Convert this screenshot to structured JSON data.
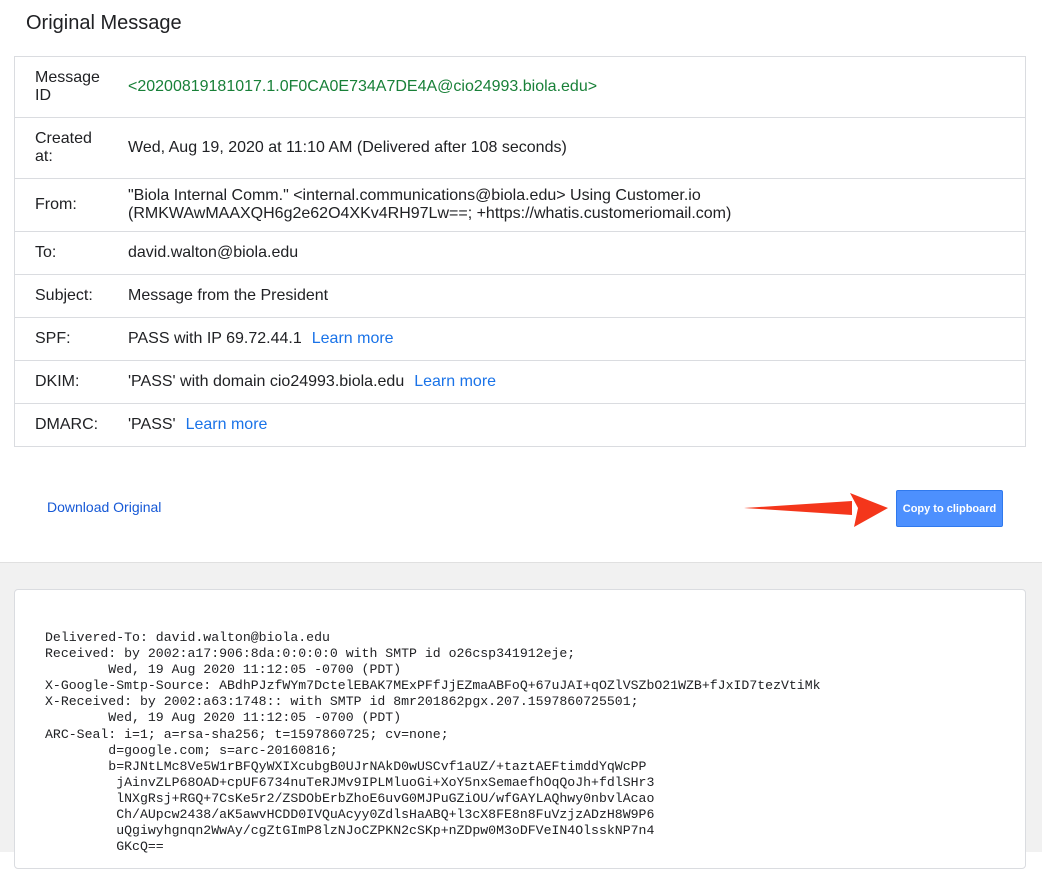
{
  "page_title": "Original Message",
  "details": {
    "message_id": {
      "label": "Message ID",
      "value": "<20200819181017.1.0F0CA0E734A7DE4A@cio24993.biola.edu>"
    },
    "created": {
      "label": "Created at:",
      "value": "Wed, Aug 19, 2020 at 11:10 AM (Delivered after 108 seconds)"
    },
    "from": {
      "label": "From:",
      "value": "\"Biola Internal Comm.\" <internal.communications@biola.edu> Using Customer.io (RMKWAwMAAXQH6g2e62O4XKv4RH97Lw==; +https://whatis.customeriomail.com)"
    },
    "to": {
      "label": "To:",
      "value": "david.walton@biola.edu"
    },
    "subject": {
      "label": "Subject:",
      "value": "Message from the President"
    },
    "spf": {
      "label": "SPF:",
      "value": "PASS with IP 69.72.44.1",
      "link": "Learn more"
    },
    "dkim": {
      "label": "DKIM:",
      "value": "'PASS' with domain cio24993.biola.edu",
      "link": "Learn more"
    },
    "dmarc": {
      "label": "DMARC:",
      "value": "'PASS'",
      "link": "Learn more"
    }
  },
  "actions": {
    "download_label": "Download Original",
    "copy_label": "Copy to clipboard"
  },
  "colors": {
    "link": "#1a73e8",
    "message_id": "#188038",
    "button": "#4d90fe",
    "arrow": "#f4361b"
  },
  "raw_source": "Delivered-To: david.walton@biola.edu\nReceived: by 2002:a17:906:8da:0:0:0:0 with SMTP id o26csp341912eje;\n        Wed, 19 Aug 2020 11:12:05 -0700 (PDT)\nX-Google-Smtp-Source: ABdhPJzfWYm7DctelEBAK7MExPFfJjEZmaABFoQ+67uJAI+qOZlVSZbO21WZB+fJxID7tezVtiMk\nX-Received: by 2002:a63:1748:: with SMTP id 8mr201862pgx.207.1597860725501;\n        Wed, 19 Aug 2020 11:12:05 -0700 (PDT)\nARC-Seal: i=1; a=rsa-sha256; t=1597860725; cv=none;\n        d=google.com; s=arc-20160816;\n        b=RJNtLMc8Ve5W1rBFQyWXIXcubgB0UJrNAkD0wUSCvf1aUZ/+taztAEFtimddYqWcPP\n         jAinvZLP68OAD+cpUF6734nuTeRJMv9IPLMluoGi+XoY5nxSemaefhOqQoJh+fdlSHr3\n         lNXgRsj+RGQ+7CsKe5r2/ZSDObErbZhoE6uvG0MJPuGZiOU/wfGAYLAQhwy0nbvlAcao\n         Ch/AUpcw2438/aK5awvHCDD0IVQuAcyy0ZdlsHaABQ+l3cX8FE8n8FuVzjzADzH8W9P6\n         uQgiwyhgnqn2WwAy/cgZtGImP8lzNJoCZPKN2cSKp+nZDpw0M3oDFVeIN4OlsskNP7n4\n         GKcQ=="
}
